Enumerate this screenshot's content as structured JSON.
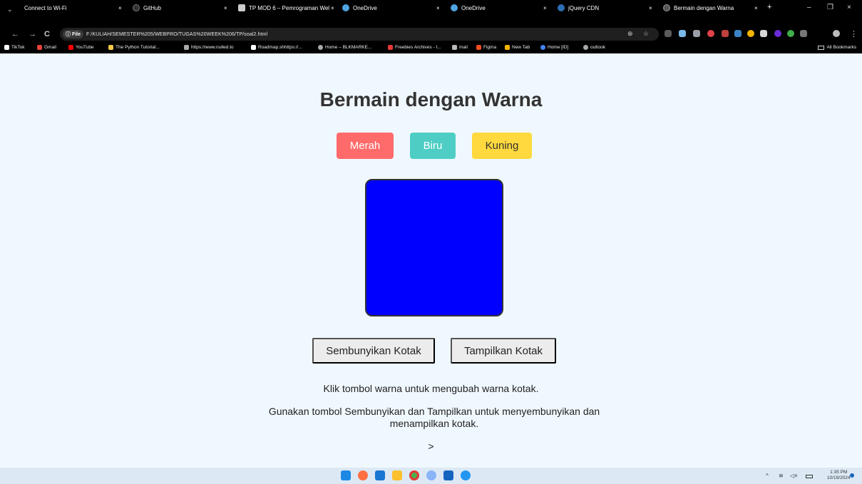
{
  "browser": {
    "tabs": [
      {
        "label": "Connect to Wi-Fi",
        "icon": "chevron-down-icon"
      },
      {
        "label": "GitHub",
        "icon": "github-icon",
        "color": "#333333"
      },
      {
        "label": "TP MOD 6 – Pemrograman Wel",
        "icon": "doc-icon",
        "color": "#cccccc"
      },
      {
        "label": "OneDrive",
        "icon": "onedrive-icon",
        "color": "#4fa3e0"
      },
      {
        "label": "OneDrive",
        "icon": "onedrive-icon",
        "color": "#4fa3e0"
      },
      {
        "label": "jQuery CDN",
        "icon": "jquery-icon",
        "color": "#2c6fb5"
      },
      {
        "label": "Bermain dengan Warna",
        "icon": "globe-icon",
        "color": "#888888",
        "active": true
      }
    ],
    "tab_close": "×",
    "new_tab": "+",
    "window": {
      "minimize": "–",
      "restore": "❐",
      "close": "×"
    },
    "nav": {
      "back": "←",
      "forward": "→",
      "reload": "C"
    },
    "address": {
      "chip": "File",
      "url": "F:/KULIAH/SEMESTER%205/WEBPRO/TUGAS%20WEEK%206/TP/soal2.html"
    },
    "omni_icons": {
      "zoom": "⊕",
      "star": "☆"
    },
    "bookmarks": [
      {
        "label": "TikTok",
        "color": "#ffffff"
      },
      {
        "label": "Gmail",
        "color": "#ea4335"
      },
      {
        "label": "YouTube",
        "color": "#ff0000"
      },
      {
        "label": "The Python Tutorial...",
        "color": "#f7c948"
      },
      {
        "label": "https://www.nulled.to",
        "color": "#aaaaaa"
      },
      {
        "label": "Roadmap.shhttps://...",
        "color": "#ffffff"
      },
      {
        "label": "Home – BLKMARKE...",
        "color": "#aaaaaa"
      },
      {
        "label": "Freebies Archives - I...",
        "color": "#e53935"
      },
      {
        "label": "mail",
        "color": "#bbbbbb"
      },
      {
        "label": "Figma",
        "color": "#f24e1e"
      },
      {
        "label": "New Tab",
        "color": "#f4b400"
      },
      {
        "label": "Home [ID]",
        "color": "#4285f4"
      },
      {
        "label": "outlook",
        "color": "#aaaaaa"
      }
    ],
    "all_bookmarks": "All Bookmarks"
  },
  "page": {
    "title": "Bermain dengan Warna",
    "color_buttons": [
      {
        "label": "Merah",
        "color": "#ff6b6b"
      },
      {
        "label": "Biru",
        "color": "#4ecdc4"
      },
      {
        "label": "Kuning",
        "color": "#ffd93d"
      }
    ],
    "box_color": "#0000ff",
    "hide_button": "Sembunyikan Kotak",
    "show_button": "Tampilkan Kotak",
    "instruction_1": "Klik tombol warna untuk mengubah warna kotak.",
    "instruction_2": "Gunakan tombol Sembunyikan dan Tampilkan untuk menyembunyikan dan menampilkan kotak.",
    "stray_text": ">"
  },
  "taskbar": {
    "apps": [
      "windows-start-icon",
      "app-icon",
      "vscode-icon",
      "file-explorer-icon",
      "chrome-icon",
      "settings-icon",
      "store-icon",
      "whatsapp-icon"
    ],
    "tray": {
      "chevron": "^"
    },
    "time": "1:35 PM",
    "date": "10/19/2024"
  }
}
